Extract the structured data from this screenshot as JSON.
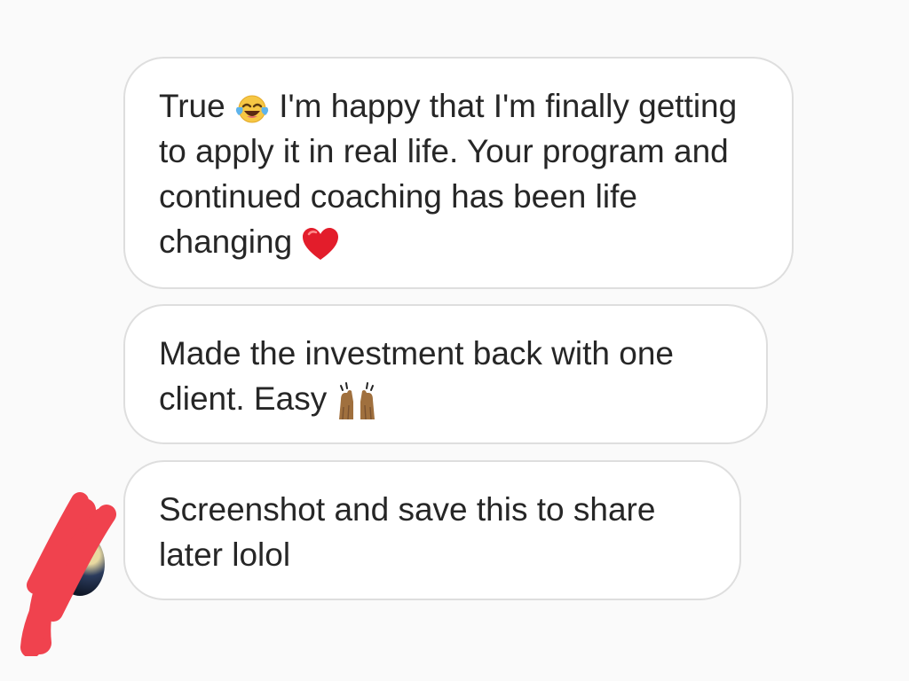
{
  "messages": [
    {
      "id": "msg-1",
      "segments": [
        {
          "type": "text",
          "value": "True "
        },
        {
          "type": "emoji",
          "name": "face-with-tears-of-joy-icon"
        },
        {
          "type": "text",
          "value": " I'm happy that I'm finally getting to apply it in real life. Your program and continued coaching has been life changing "
        },
        {
          "type": "emoji",
          "name": "red-heart-icon"
        }
      ]
    },
    {
      "id": "msg-2",
      "segments": [
        {
          "type": "text",
          "value": "Made the investment back with one client. Easy "
        },
        {
          "type": "emoji",
          "name": "raising-hands-icon"
        }
      ]
    },
    {
      "id": "msg-3",
      "segments": [
        {
          "type": "text",
          "value": "Screenshot and save this to share later lolol"
        }
      ]
    }
  ],
  "colors": {
    "background": "#fafafa",
    "bubble": "#ffffff",
    "bubble_border": "#dedede",
    "text": "#262626",
    "redaction": "#f0424e"
  }
}
